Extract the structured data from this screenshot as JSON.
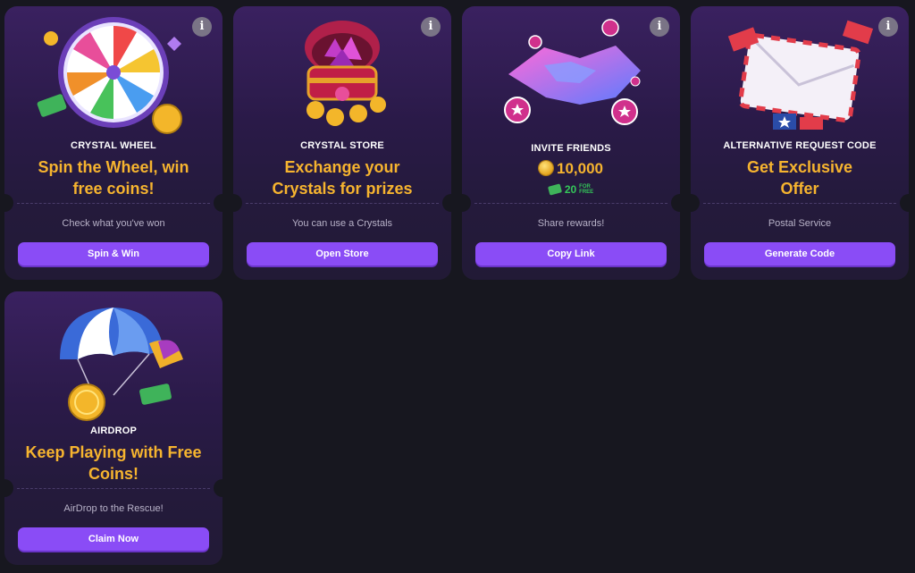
{
  "cards": [
    {
      "label": "CRYSTAL WHEEL",
      "headline_line1": "Spin the Wheel, win",
      "headline_line2": "free coins!",
      "subtext": "Check what you've won",
      "button": "Spin & Win",
      "icon": "prize-wheel-icon"
    },
    {
      "label": "CRYSTAL STORE",
      "headline_line1": "Exchange your",
      "headline_line2": "Crystals for prizes",
      "subtext": "You can use a Crystals",
      "button": "Open Store",
      "icon": "treasure-chest-icon"
    },
    {
      "label": "INVITE FRIENDS",
      "reward_coins": "10,000",
      "reward_cash": "20",
      "reward_cash_tag_line1": "FOR",
      "reward_cash_tag_line2": "FREE",
      "subtext": "Share rewards!",
      "button": "Copy Link",
      "icon": "handshake-icon"
    },
    {
      "label": "ALTERNATIVE REQUEST CODE",
      "headline_line1": "Get Exclusive",
      "headline_line2": "Offer",
      "subtext": "Postal Service",
      "button": "Generate Code",
      "icon": "envelope-icon"
    },
    {
      "label": "AIRDROP",
      "headline_line1": "Keep Playing with Free",
      "headline_line2": "Coins!",
      "subtext": "AirDrop to the Rescue!",
      "button": "Claim Now",
      "icon": "parachute-icon"
    }
  ],
  "info_glyph": "i",
  "colors": {
    "page_bg": "#17171f",
    "card_bg_top": "#3a2160",
    "card_bg_bottom": "#221a36",
    "headline": "#f6b42f",
    "button": "#8a4cf6",
    "bonus_green": "#34c759"
  }
}
